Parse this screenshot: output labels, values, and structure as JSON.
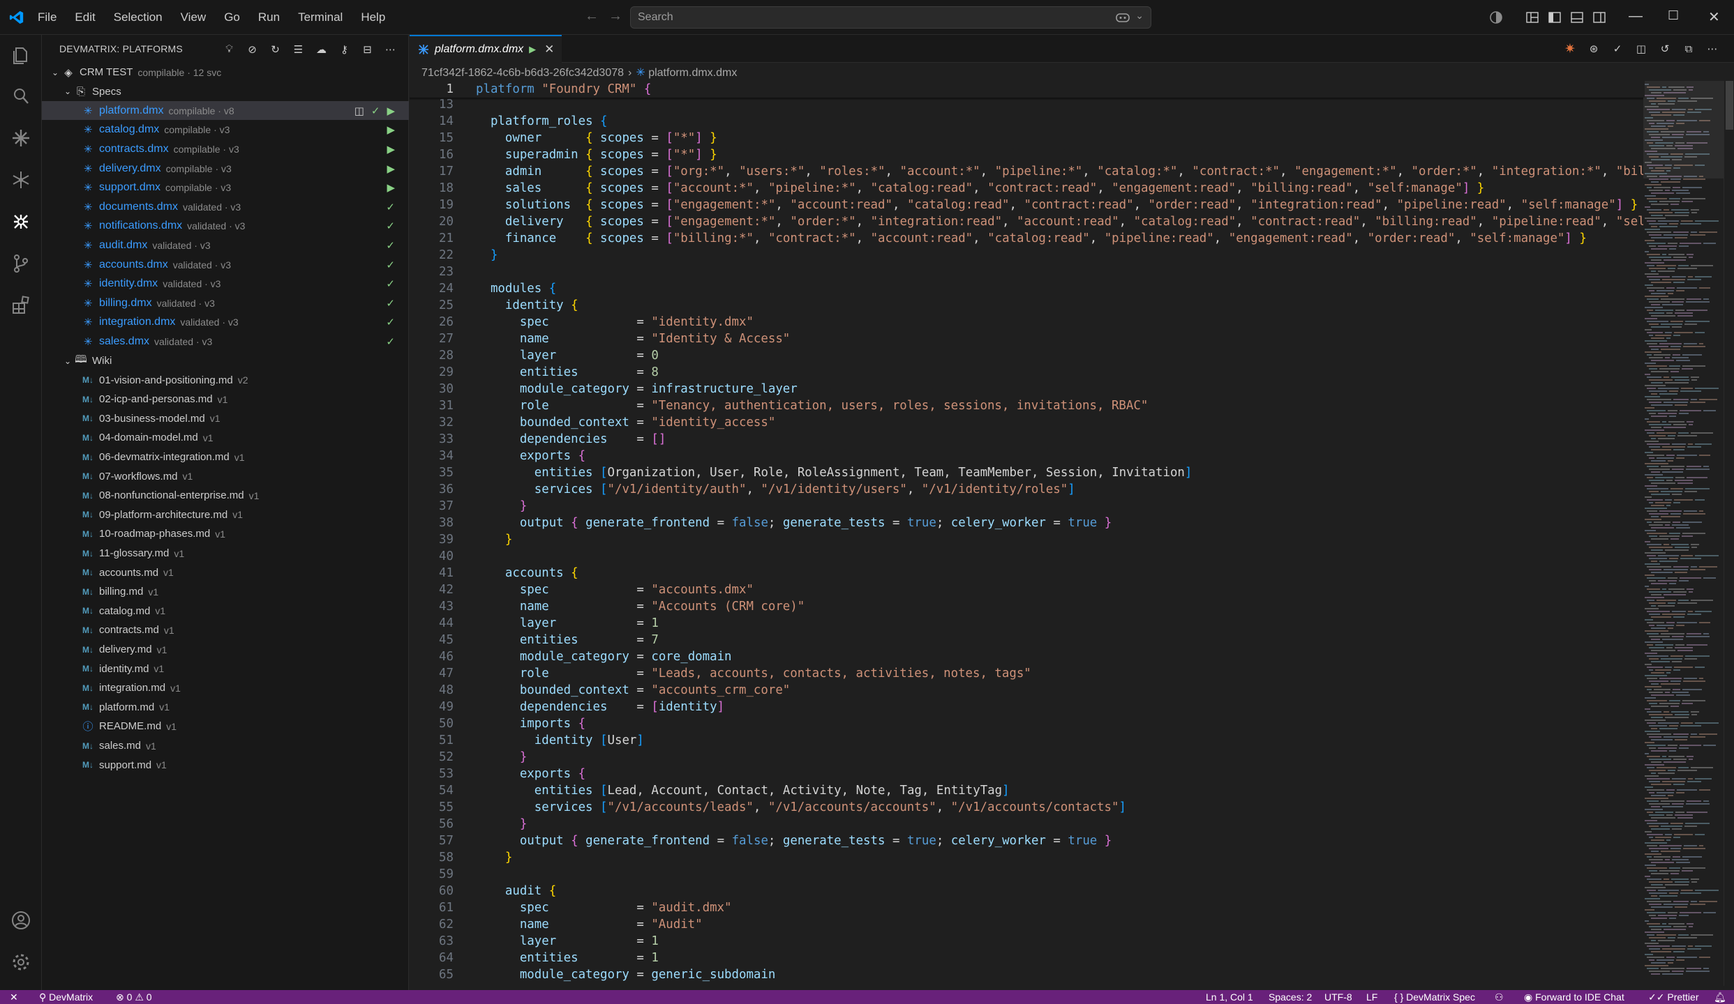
{
  "menu": [
    "File",
    "Edit",
    "Selection",
    "View",
    "Go",
    "Run",
    "Terminal",
    "Help"
  ],
  "search": {
    "placeholder": "Search"
  },
  "sidebar": {
    "title": "DEVMATRIX: PLATFORMS",
    "project": {
      "name": "CRM TEST",
      "meta": "compilable · 12 svc"
    },
    "specs_label": "Specs",
    "specs": [
      {
        "name": "platform.dmx",
        "meta": "compilable · v8"
      },
      {
        "name": "catalog.dmx",
        "meta": "compilable · v3"
      },
      {
        "name": "contracts.dmx",
        "meta": "compilable · v3"
      },
      {
        "name": "delivery.dmx",
        "meta": "compilable · v3"
      },
      {
        "name": "support.dmx",
        "meta": "compilable · v3"
      },
      {
        "name": "documents.dmx",
        "meta": "validated · v3"
      },
      {
        "name": "notifications.dmx",
        "meta": "validated · v3"
      },
      {
        "name": "audit.dmx",
        "meta": "validated · v3"
      },
      {
        "name": "accounts.dmx",
        "meta": "validated · v3"
      },
      {
        "name": "identity.dmx",
        "meta": "validated · v3"
      },
      {
        "name": "billing.dmx",
        "meta": "validated · v3"
      },
      {
        "name": "integration.dmx",
        "meta": "validated · v3"
      },
      {
        "name": "sales.dmx",
        "meta": "validated · v3"
      }
    ],
    "wiki_label": "Wiki",
    "wiki": [
      {
        "name": "01-vision-and-positioning.md",
        "meta": "v2"
      },
      {
        "name": "02-icp-and-personas.md",
        "meta": "v1"
      },
      {
        "name": "03-business-model.md",
        "meta": "v1"
      },
      {
        "name": "04-domain-model.md",
        "meta": "v1"
      },
      {
        "name": "06-devmatrix-integration.md",
        "meta": "v1"
      },
      {
        "name": "07-workflows.md",
        "meta": "v1"
      },
      {
        "name": "08-nonfunctional-enterprise.md",
        "meta": "v1"
      },
      {
        "name": "09-platform-architecture.md",
        "meta": "v1"
      },
      {
        "name": "10-roadmap-phases.md",
        "meta": "v1"
      },
      {
        "name": "11-glossary.md",
        "meta": "v1"
      },
      {
        "name": "accounts.md",
        "meta": "v1"
      },
      {
        "name": "billing.md",
        "meta": "v1"
      },
      {
        "name": "catalog.md",
        "meta": "v1"
      },
      {
        "name": "contracts.md",
        "meta": "v1"
      },
      {
        "name": "delivery.md",
        "meta": "v1"
      },
      {
        "name": "identity.md",
        "meta": "v1"
      },
      {
        "name": "integration.md",
        "meta": "v1"
      },
      {
        "name": "platform.md",
        "meta": "v1"
      },
      {
        "name": "README.md",
        "meta": "v1"
      },
      {
        "name": "sales.md",
        "meta": "v1"
      },
      {
        "name": "support.md",
        "meta": "v1"
      }
    ]
  },
  "editor": {
    "tab": "platform.dmx.dmx",
    "breadcrumb": [
      "71cf342f-1862-4c6b-b6d3-26fc342d3078",
      "platform.dmx.dmx"
    ],
    "sticky": {
      "num": "1",
      "text": "platform \"Foundry CRM\" {"
    },
    "lines": [
      {
        "n": "13",
        "t": ""
      },
      {
        "n": "14",
        "t": "  platform_roles {"
      },
      {
        "n": "15",
        "t": "    owner      { scopes = [\"*\"] }"
      },
      {
        "n": "16",
        "t": "    superadmin { scopes = [\"*\"] }"
      },
      {
        "n": "17",
        "t": "    admin      { scopes = [\"org:*\", \"users:*\", \"roles:*\", \"account:*\", \"pipeline:*\", \"catalog:*\", \"contract:*\", \"engagement:*\", \"order:*\", \"integration:*\", \"billing:*\", \"audit:read\", \"self:manage\"] }"
      },
      {
        "n": "18",
        "t": "    sales      { scopes = [\"account:*\", \"pipeline:*\", \"catalog:read\", \"contract:read\", \"engagement:read\", \"billing:read\", \"self:manage\"] }"
      },
      {
        "n": "19",
        "t": "    solutions  { scopes = [\"engagement:*\", \"account:read\", \"catalog:read\", \"contract:read\", \"order:read\", \"integration:read\", \"pipeline:read\", \"self:manage\"] }"
      },
      {
        "n": "20",
        "t": "    delivery   { scopes = [\"engagement:*\", \"order:*\", \"integration:read\", \"account:read\", \"catalog:read\", \"contract:read\", \"billing:read\", \"pipeline:read\", \"self:manage\"] }"
      },
      {
        "n": "21",
        "t": "    finance    { scopes = [\"billing:*\", \"contract:*\", \"account:read\", \"catalog:read\", \"pipeline:read\", \"engagement:read\", \"order:read\", \"self:manage\"] }"
      },
      {
        "n": "22",
        "t": "  }"
      },
      {
        "n": "23",
        "t": ""
      },
      {
        "n": "24",
        "t": "  modules {"
      },
      {
        "n": "25",
        "t": "    identity {"
      },
      {
        "n": "26",
        "t": "      spec            = \"identity.dmx\""
      },
      {
        "n": "27",
        "t": "      name            = \"Identity & Access\""
      },
      {
        "n": "28",
        "t": "      layer           = 0"
      },
      {
        "n": "29",
        "t": "      entities        = 8"
      },
      {
        "n": "30",
        "t": "      module_category = infrastructure_layer"
      },
      {
        "n": "31",
        "t": "      role            = \"Tenancy, authentication, users, roles, sessions, invitations, RBAC\""
      },
      {
        "n": "32",
        "t": "      bounded_context = \"identity_access\""
      },
      {
        "n": "33",
        "t": "      dependencies    = []"
      },
      {
        "n": "34",
        "t": "      exports {"
      },
      {
        "n": "35",
        "t": "        entities [Organization, User, Role, RoleAssignment, Team, TeamMember, Session, Invitation]"
      },
      {
        "n": "36",
        "t": "        services [\"/v1/identity/auth\", \"/v1/identity/users\", \"/v1/identity/roles\"]"
      },
      {
        "n": "37",
        "t": "      }"
      },
      {
        "n": "38",
        "t": "      output { generate_frontend = false; generate_tests = true; celery_worker = true }"
      },
      {
        "n": "39",
        "t": "    }"
      },
      {
        "n": "40",
        "t": ""
      },
      {
        "n": "41",
        "t": "    accounts {"
      },
      {
        "n": "42",
        "t": "      spec            = \"accounts.dmx\""
      },
      {
        "n": "43",
        "t": "      name            = \"Accounts (CRM core)\""
      },
      {
        "n": "44",
        "t": "      layer           = 1"
      },
      {
        "n": "45",
        "t": "      entities        = 7"
      },
      {
        "n": "46",
        "t": "      module_category = core_domain"
      },
      {
        "n": "47",
        "t": "      role            = \"Leads, accounts, contacts, activities, notes, tags\""
      },
      {
        "n": "48",
        "t": "      bounded_context = \"accounts_crm_core\""
      },
      {
        "n": "49",
        "t": "      dependencies    = [identity]"
      },
      {
        "n": "50",
        "t": "      imports {"
      },
      {
        "n": "51",
        "t": "        identity [User]"
      },
      {
        "n": "52",
        "t": "      }"
      },
      {
        "n": "53",
        "t": "      exports {"
      },
      {
        "n": "54",
        "t": "        entities [Lead, Account, Contact, Activity, Note, Tag, EntityTag]"
      },
      {
        "n": "55",
        "t": "        services [\"/v1/accounts/leads\", \"/v1/accounts/accounts\", \"/v1/accounts/contacts\"]"
      },
      {
        "n": "56",
        "t": "      }"
      },
      {
        "n": "57",
        "t": "      output { generate_frontend = false; generate_tests = true; celery_worker = true }"
      },
      {
        "n": "58",
        "t": "    }"
      },
      {
        "n": "59",
        "t": ""
      },
      {
        "n": "60",
        "t": "    audit {"
      },
      {
        "n": "61",
        "t": "      spec            = \"audit.dmx\""
      },
      {
        "n": "62",
        "t": "      name            = \"Audit\""
      },
      {
        "n": "63",
        "t": "      layer           = 1"
      },
      {
        "n": "64",
        "t": "      entities        = 1"
      },
      {
        "n": "65",
        "t": "      module_category = generic_subdomain"
      }
    ]
  },
  "status": {
    "branch": "DevMatrix",
    "problems": "0",
    "warnings": "0",
    "position": "Ln 1, Col 1",
    "spaces": "Spaces: 2",
    "encoding": "UTF-8",
    "eol": "LF",
    "language": "DevMatrix Spec",
    "forward": "Forward to IDE Chat",
    "formatter": "Prettier"
  },
  "colors": {
    "accent": "#0078d4",
    "statusbar": "#68217a",
    "link": "#3b9cff",
    "ok": "#89d185"
  }
}
